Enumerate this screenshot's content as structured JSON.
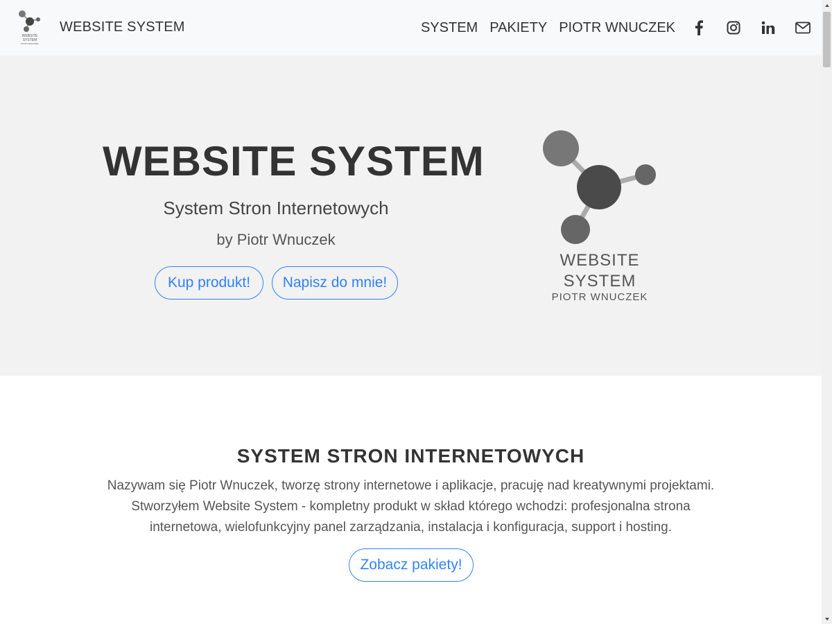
{
  "navbar": {
    "brand_text": "WEBSITE SYSTEM",
    "links": [
      "SYSTEM",
      "PAKIETY",
      "PIOTR WNUCZEK"
    ],
    "icons": [
      "facebook-icon",
      "instagram-icon",
      "linkedin-icon",
      "mail-icon"
    ]
  },
  "hero": {
    "title": "WEBSITE SYSTEM",
    "subtitle": "System Stron Internetowych",
    "byline": "by Piotr Wnuczek",
    "buttons": {
      "buy": "Kup produkt!",
      "contact": "Napisz do mnie!"
    },
    "logo": {
      "line1": "WEBSITE",
      "line2": "SYSTEM",
      "line3": "PIOTR WNUCZEK"
    }
  },
  "section": {
    "title": "SYSTEM STRON INTERNETOWYCH",
    "body": "Nazywam się Piotr Wnuczek, tworzę strony internetowe i aplikacje, pracuję nad kreatywnymi projektami. Stworzyłem Website System - kompletny produkt w skład którego wchodzi: profesjonalna strona internetowa, wielofunkcyjny panel zarządzania, instalacja i konfiguracja, support i hosting.",
    "button": "Zobacz pakiety!"
  },
  "colors": {
    "accent": "#0d6efd",
    "navbar_bg": "#f8f9fa",
    "hero_bg": "#f2f2f2",
    "text": "#333333"
  }
}
